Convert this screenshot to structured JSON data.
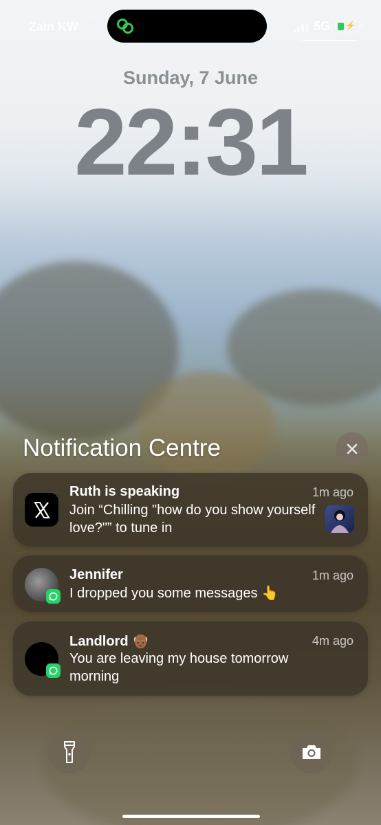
{
  "status_bar": {
    "carrier": "Zain KW",
    "network": "5G",
    "battery_level": 0.3,
    "battery_color": "#34c759",
    "island_icon": "link-loop-icon"
  },
  "lock_screen": {
    "date": "Sunday, 7 June",
    "time": "22:31"
  },
  "notification_centre": {
    "title": "Notification Centre",
    "close_icon": "close-icon"
  },
  "notifications": [
    {
      "app": "X",
      "app_icon": "x-logo-icon",
      "title": "Ruth is speaking",
      "time": "1m ago",
      "body": "Join “Chilling \"how do you show yourself love?\"” to tune in"
    },
    {
      "app": "WhatsApp",
      "app_icon": "whatsapp-icon",
      "title": "Jennifer",
      "time": "1m ago",
      "body": "I dropped you some messages 👆"
    },
    {
      "app": "WhatsApp",
      "app_icon": "whatsapp-icon",
      "title": "Landlord 👴🏾",
      "time": "4m ago",
      "body": "You are leaving my house tomorrow morning"
    }
  ],
  "controls": {
    "left_icon": "flashlight-icon",
    "right_icon": "camera-icon"
  }
}
